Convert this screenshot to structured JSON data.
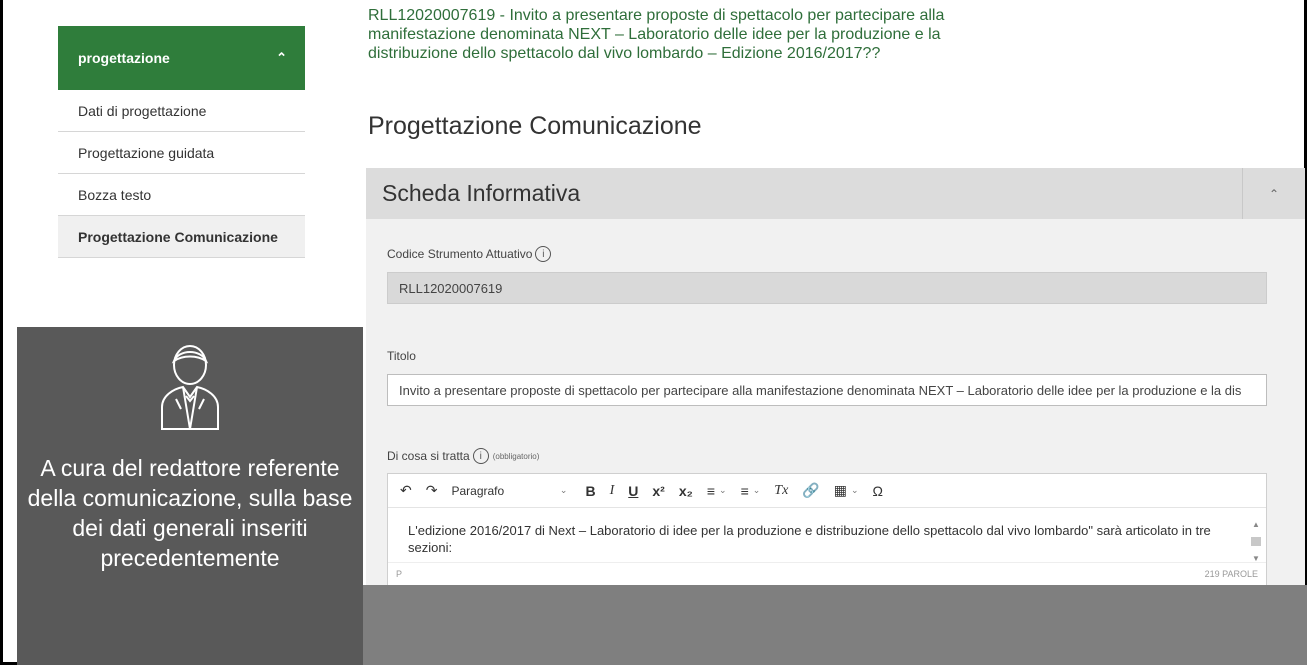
{
  "breadcrumb": {
    "text": "RLL12020007619 - Invito a presentare proposte di spettacolo per partecipare alla manifestazione denominata NEXT – Laboratorio delle idee per la produzione e la distribuzione dello spettacolo dal vivo lombardo – Edizione 2016/2017??"
  },
  "sidebar": {
    "section_label": "progettazione",
    "toggle_icon": "chevron-up-icon",
    "items": [
      {
        "label": "Dati di progettazione",
        "active": false
      },
      {
        "label": "Progettazione guidata",
        "active": false
      },
      {
        "label": "Bozza testo",
        "active": false
      },
      {
        "label": "Progettazione Comunicazione",
        "active": true
      }
    ]
  },
  "page": {
    "title": "Progettazione Comunicazione"
  },
  "panel": {
    "title": "Scheda Informativa",
    "toggle_icon": "chevron-up-icon",
    "codice": {
      "label": "Codice Strumento Attuativo",
      "value": "RLL12020007619"
    },
    "titolo": {
      "label": "Titolo",
      "value": "Invito a presentare proposte di spettacolo per partecipare alla manifestazione denominata  NEXT – Laboratorio delle idee per la produzione e la dis"
    },
    "di_cosa": {
      "label": "Di cosa si tratta",
      "required": "(obbligatorio)",
      "toolbar": {
        "undo_icon": "undo-icon",
        "redo_icon": "redo-icon",
        "format": "Paragrafo",
        "bold": "B",
        "italic": "I",
        "underline": "U",
        "superscript": "x²",
        "subscript": "x₂",
        "clear_format": "Tx",
        "omega": "Ω"
      },
      "content": "L'edizione 2016/2017 di  Next – Laboratorio di idee per la produzione e distribuzione dello spettacolo dal vivo lombardo\" sarà articolato in tre sezioni:",
      "status_path": "P",
      "word_count": "219 PAROLE"
    }
  },
  "overlay": {
    "icon": "person-suit-icon",
    "text": "A cura del redattore referente della comunicazione, sulla base dei dati generali inseriti precedentemente"
  },
  "colors": {
    "brand_green": "#2f7d3b",
    "overlay_gray": "#595959",
    "band_gray": "#7f7f7f"
  }
}
